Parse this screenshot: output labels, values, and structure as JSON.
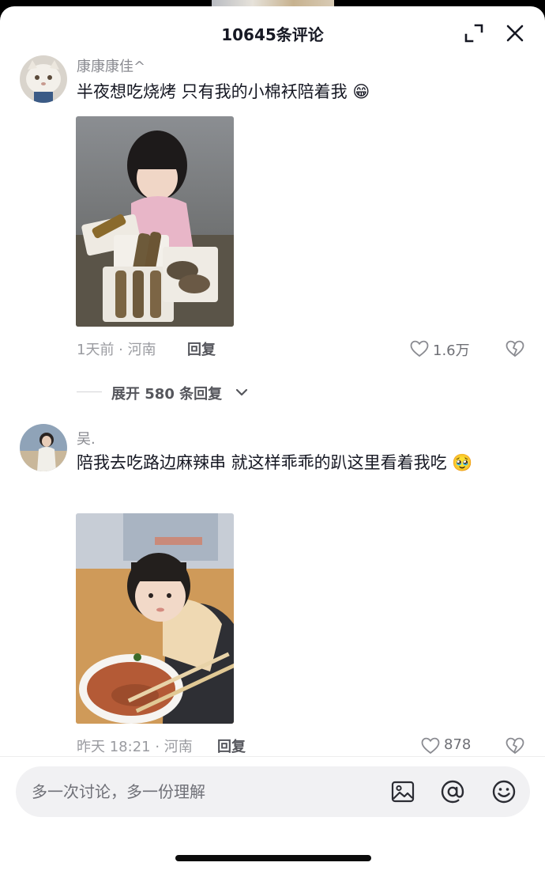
{
  "header": {
    "title": "10645条评论"
  },
  "comments": [
    {
      "username": "康康康佳^",
      "text": "半夜想吃烧烤 只有我的小棉袄陪着我 😁",
      "time_location": "1天前 · 河南",
      "reply_label": "回复",
      "like_count": "1.6万"
    },
    {
      "username": "吴.",
      "text": "陪我去吃路边麻辣串 就这样乖乖的趴这里看着我吃 🥹",
      "time_location": "昨天 18:21 · 河南",
      "reply_label": "回复",
      "like_count": "878"
    }
  ],
  "expand_replies": {
    "label": "展开 580 条回复"
  },
  "composer": {
    "placeholder": "多一次讨论，多一份理解"
  },
  "colors": {
    "text_primary": "#161823",
    "text_secondary": "#8a8b91",
    "input_bg": "#f1f1f3"
  },
  "icons": [
    "expand-icon",
    "close-icon",
    "heart-icon",
    "broken-heart-icon",
    "chevron-down-icon",
    "image-icon",
    "at-icon",
    "emoji-icon"
  ]
}
